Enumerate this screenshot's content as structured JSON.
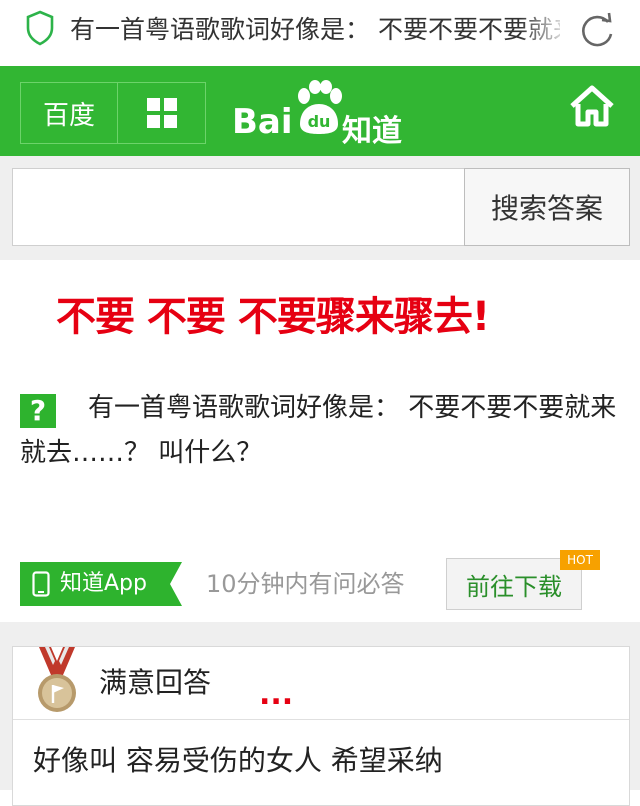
{
  "browser": {
    "page_title": "有一首粤语歌歌词好像是： 不要不要不要就来就去……？叫什么？"
  },
  "header": {
    "nav_baidu": "百度",
    "logo_bai": "Bai",
    "logo_du": "du",
    "logo_zhidao": "知道",
    "brand_color": "#32b633"
  },
  "search": {
    "value": "",
    "placeholder": "",
    "button_label": "搜索答案"
  },
  "question": {
    "overlay_caption": "不要 不要 不要骤来骤去!",
    "icon_label": "?",
    "text": "有一首粤语歌歌词好像是： 不要不要不要就来就去……？ 叫什么？"
  },
  "app_promo": {
    "badge_label": "知道App",
    "tagline": "10分钟内有问必答",
    "download_label": "前往下载",
    "hot_label": "HOT"
  },
  "answer": {
    "title": "满意回答",
    "ellipsis": "...",
    "text": "好像叫 容易受伤的女人 希望采纳"
  },
  "colors": {
    "accent_red": "#e60012",
    "hot_orange": "#f7a100"
  }
}
